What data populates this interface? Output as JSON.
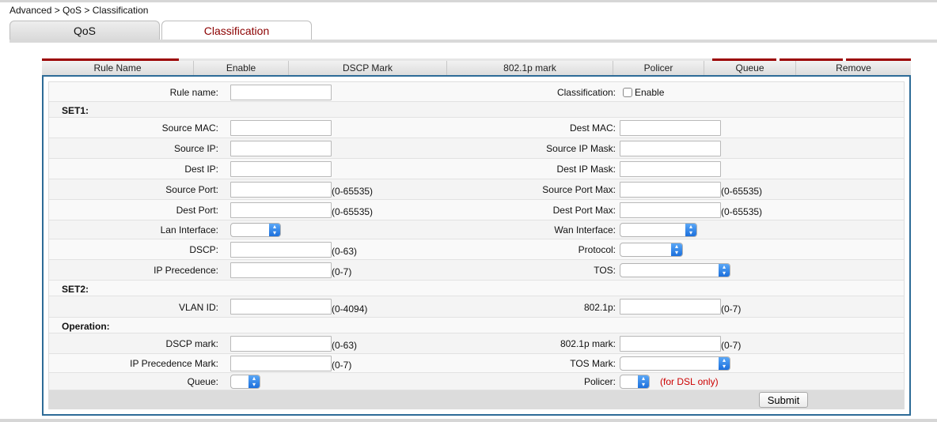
{
  "breadcrumb": "Advanced > QoS > Classification",
  "tabs": [
    {
      "label": "QoS",
      "active": false
    },
    {
      "label": "Classification",
      "active": true
    }
  ],
  "table_headers": [
    "Rule Name",
    "Enable",
    "DSCP Mark",
    "802.1p mark",
    "Policer",
    "Queue",
    "Remove"
  ],
  "form": {
    "rule_name_label": "Rule name:",
    "classification_label": "Classification:",
    "classification_enable": "Enable",
    "set1": "SET1:",
    "source_mac": "Source MAC:",
    "dest_mac": "Dest MAC:",
    "source_ip": "Source IP:",
    "source_ip_mask": "Source IP Mask:",
    "dest_ip": "Dest IP:",
    "dest_ip_mask": "Dest IP Mask:",
    "source_port": "Source Port:",
    "source_port_max": "Source Port Max:",
    "dest_port": "Dest Port:",
    "dest_port_max": "Dest Port Max:",
    "lan_interface": "Lan Interface:",
    "wan_interface": "Wan Interface:",
    "dscp": "DSCP:",
    "protocol": "Protocol:",
    "ip_precedence": "IP Precedence:",
    "tos": "TOS:",
    "set2": "SET2:",
    "vlan_id": "VLAN ID:",
    "dot1p": "802.1p:",
    "operation": "Operation:",
    "dscp_mark": "DSCP mark:",
    "dot1p_mark": "802.1p mark:",
    "ip_precedence_mark": "IP Precedence Mark:",
    "tos_mark": "TOS Mark:",
    "queue": "Queue:",
    "policer": "Policer:",
    "hint_port": "(0-65535)",
    "hint_dscp": "(0-63)",
    "hint_prec": "(0-7)",
    "hint_vlan": "(0-4094)",
    "hint_dsl": "(for DSL only)",
    "submit": "Submit"
  },
  "colors": {
    "accent_red": "#9b0000",
    "tab_active_text": "#8b0000",
    "panel_border": "#2d6b97",
    "select_arrow": "#1b6fdc"
  }
}
